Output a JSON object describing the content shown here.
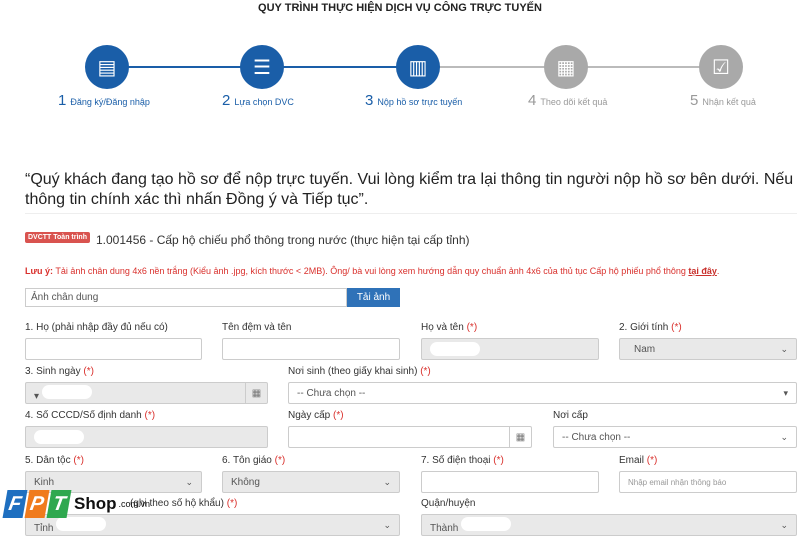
{
  "header": {
    "title": "QUY TRÌNH THỰC HIỆN DỊCH VỤ CÔNG TRỰC TUYẾN"
  },
  "colors": {
    "active": "#1a5ea8",
    "inactive": "#a9a9a9",
    "required": "#d9302c",
    "button": "#2f72b8"
  },
  "steps": [
    {
      "num": "1",
      "label": "Đăng ký/Đăng nhập",
      "icon": "id-card-icon",
      "active": true
    },
    {
      "num": "2",
      "label": "Lựa chọn DVC",
      "icon": "list-icon",
      "active": true
    },
    {
      "num": "3",
      "label": "Nộp hồ sơ trực tuyến",
      "icon": "document-upload-icon",
      "active": true
    },
    {
      "num": "4",
      "label": "Theo dõi kết quả",
      "icon": "clipboard-icon",
      "active": false
    },
    {
      "num": "5",
      "label": "Nhận kết quả",
      "icon": "checkbox-icon",
      "active": false
    }
  ],
  "notice": "“Quý khách đang tạo hồ sơ để nộp trực tuyến. Vui lòng kiểm tra lại thông tin người nộp hồ sơ bên dưới. Nếu thông tin chính xác thì nhấn Đồng ý và Tiếp tục”.",
  "procedure": {
    "badge": "DVCTT Toàn trình",
    "name": "1.001456 - Cấp hộ chiếu phổ thông trong nước (thực hiện tại cấp tỉnh)"
  },
  "warning": {
    "prefix": "Lưu ý:",
    "text": " Tải ảnh chân dung 4x6 nền trắng (Kiểu ảnh .jpg, kích thước < 2MB). Ông/ bà vui lòng xem hướng dẫn quy chuẩn ảnh 4x6 của thủ tục Cấp hộ phiếu phổ thông ",
    "link": "tại đây",
    "suffix": "."
  },
  "upload": {
    "placeholder": "Ảnh chân dung",
    "button": "Tải ảnh"
  },
  "form": {
    "ho": "1. Họ (phải nhập đầy đủ nếu có)",
    "ten": "Tên đệm và tên",
    "hoten": "Họ và tên",
    "gioitinh": "2. Giới tính",
    "gioitinh_value": "Nam",
    "sinhngay": "3. Sinh ngày",
    "noisinh": "Nơi sinh (theo giấy khai sinh)",
    "noisinh_value": "-- Chưa chọn --",
    "cccd": "4. Số CCCD/Số định danh",
    "ngaycap": "Ngày cấp",
    "noicap": "Nơi cấp",
    "noicap_value": "-- Chưa chọn --",
    "dantoc": "5. Dân tộc",
    "dantoc_value": "Kinh",
    "tongiao": "6. Tôn giáo",
    "tongiao_value": "Không",
    "sdt": "7. Số điện thoại",
    "email": "Email",
    "email_placeholder": "Nhập email nhận thông báo",
    "thuongtru": "(ghi theo số hộ khẩu)",
    "thuongtru_value": "Tỉnh",
    "quanhuyen": "Quận/huyện",
    "quanhuyen_value": "Thành",
    "required_mark": "(*)"
  },
  "watermark": {
    "brand": "FPT Shop",
    "domain": ".com.vn"
  }
}
